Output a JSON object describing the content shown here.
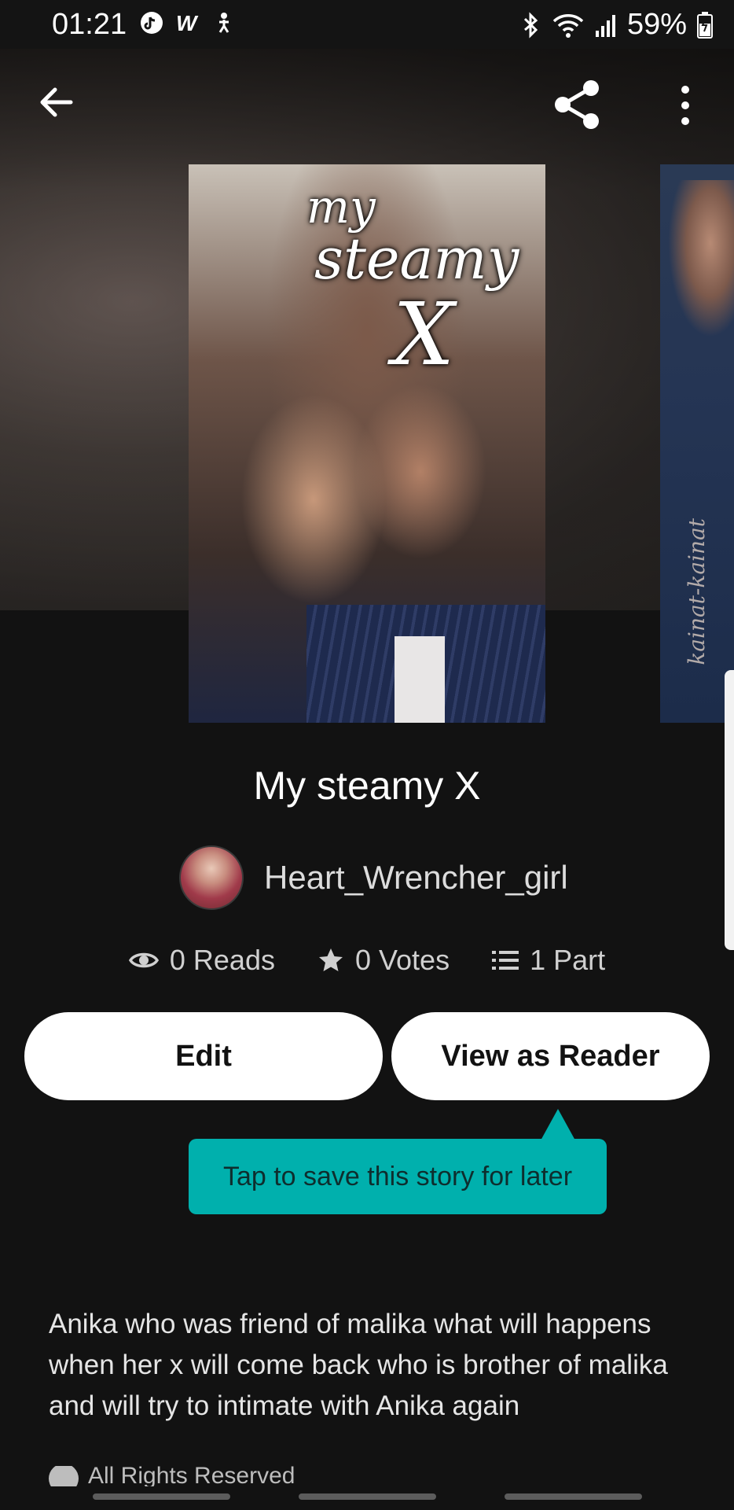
{
  "status": {
    "time": "01:21",
    "left_icons": [
      "tiktok-icon",
      "webtoon-icon",
      "accessibility-icon"
    ],
    "right_icons": [
      "bluetooth-icon",
      "wifi-icon",
      "signal-icon",
      "battery-icon"
    ],
    "battery_percent": "59%"
  },
  "header": {
    "back_icon": "arrow-left-icon",
    "share_icon": "share-icon",
    "more_icon": "more-vertical-icon"
  },
  "cover": {
    "title_line1": "my",
    "title_line2": "steamy",
    "title_line3": "X",
    "next_cover_signature": "kainat-kainat"
  },
  "story": {
    "title": "My steamy X",
    "author": "Heart_Wrencher_girl",
    "stats": {
      "reads": "0 Reads",
      "votes": "0 Votes",
      "parts": "1 Part"
    },
    "description": "Anika who was friend of malika what will happens when her x will come back who is brother of malika and will try to intimate with Anika again",
    "rights": "All Rights Reserved"
  },
  "actions": {
    "edit_label": "Edit",
    "view_label": "View as Reader"
  },
  "tooltip": {
    "text": "Tap to save this story for later",
    "color": "#00b0ad"
  }
}
